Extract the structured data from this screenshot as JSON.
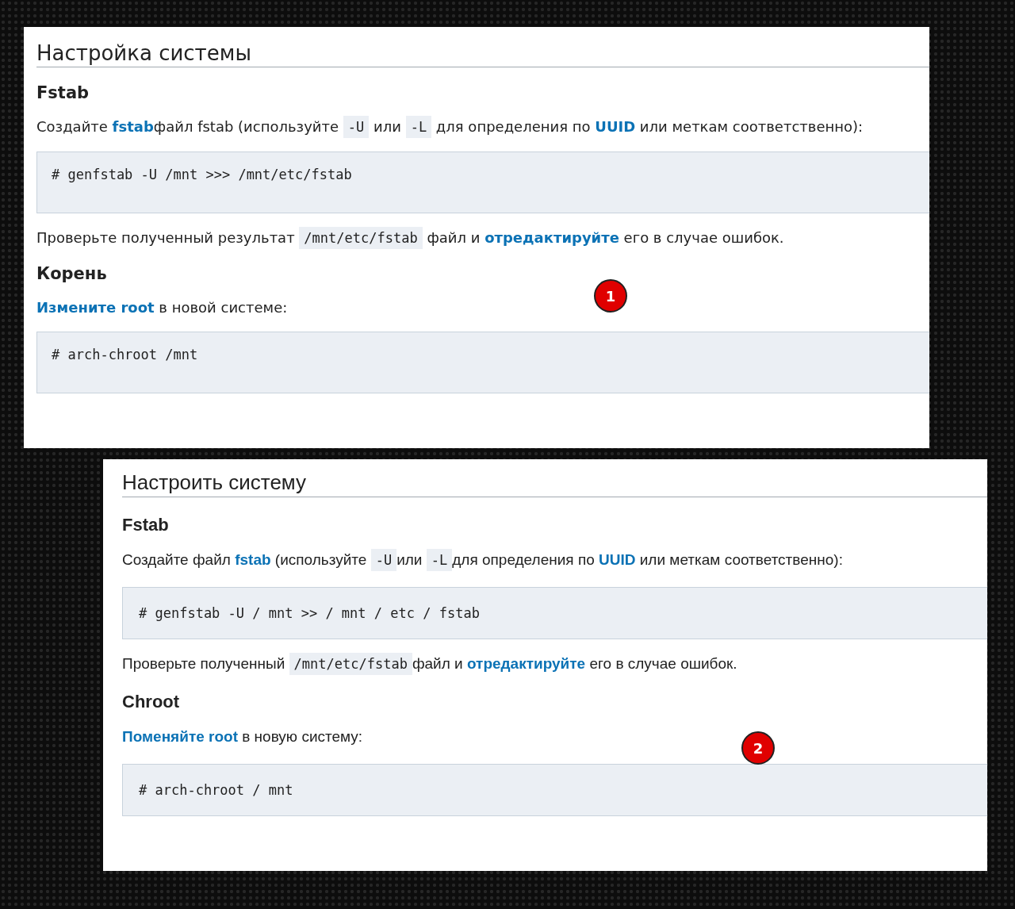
{
  "panels": [
    {
      "badge": "1",
      "title": "Настройка системы",
      "sections": [
        {
          "heading": "Fstab",
          "blocks": [
            {
              "kind": "paragraph",
              "parts": [
                {
                  "kind": "text",
                  "text": "Создайте "
                },
                {
                  "kind": "link",
                  "text": "fstab"
                },
                {
                  "kind": "text",
                  "text": "файл fstab (используйте "
                },
                {
                  "kind": "code",
                  "text": "-U"
                },
                {
                  "kind": "text",
                  "text": " или "
                },
                {
                  "kind": "code",
                  "text": "-L"
                },
                {
                  "kind": "text",
                  "text": " для определения по "
                },
                {
                  "kind": "link",
                  "text": "UUID"
                },
                {
                  "kind": "text",
                  "text": " или меткам соответственно):"
                }
              ]
            },
            {
              "kind": "code",
              "text": "# genfstab -U /mnt >>> /mnt/etc/fstab"
            },
            {
              "kind": "paragraph",
              "parts": [
                {
                  "kind": "text",
                  "text": "Проверьте полученный результат "
                },
                {
                  "kind": "code",
                  "text": "/mnt/etc/fstab"
                },
                {
                  "kind": "text",
                  "text": " файл и "
                },
                {
                  "kind": "link",
                  "text": "отредактируйте"
                },
                {
                  "kind": "text",
                  "text": " его в случае ошибок."
                }
              ]
            }
          ]
        },
        {
          "heading": "Корень",
          "blocks": [
            {
              "kind": "paragraph",
              "parts": [
                {
                  "kind": "link",
                  "text": "Измените root"
                },
                {
                  "kind": "text",
                  "text": " в новой системе:"
                }
              ]
            },
            {
              "kind": "code",
              "text": "# arch-chroot /mnt"
            }
          ]
        }
      ]
    },
    {
      "badge": "2",
      "title": "Настроить систему",
      "sections": [
        {
          "heading": "Fstab",
          "blocks": [
            {
              "kind": "paragraph",
              "parts": [
                {
                  "kind": "text",
                  "text": "Создайте файл "
                },
                {
                  "kind": "link",
                  "text": "fstab"
                },
                {
                  "kind": "text",
                  "text": " (используйте "
                },
                {
                  "kind": "code",
                  "text": "-U"
                },
                {
                  "kind": "text",
                  "text": "или "
                },
                {
                  "kind": "code",
                  "text": "-L"
                },
                {
                  "kind": "text",
                  "text": "для определения по "
                },
                {
                  "kind": "link",
                  "text": "UUID"
                },
                {
                  "kind": "text",
                  "text": " или меткам соответственно):"
                }
              ]
            },
            {
              "kind": "code",
              "text": "# genfstab -U / mnt >> / mnt / etc / fstab"
            },
            {
              "kind": "paragraph",
              "parts": [
                {
                  "kind": "text",
                  "text": "Проверьте полученный "
                },
                {
                  "kind": "code",
                  "text": "/mnt/etc/fstab"
                },
                {
                  "kind": "text",
                  "text": "файл и "
                },
                {
                  "kind": "link",
                  "text": "отредактируйте"
                },
                {
                  "kind": "text",
                  "text": " его в случае ошибок."
                }
              ]
            }
          ]
        },
        {
          "heading": "Chroot",
          "blocks": [
            {
              "kind": "paragraph",
              "parts": [
                {
                  "kind": "link",
                  "text": "Поменяйте root"
                },
                {
                  "kind": "text",
                  "text": " в новую систему:"
                }
              ]
            },
            {
              "kind": "code",
              "text": "# arch-chroot / mnt"
            }
          ]
        }
      ]
    }
  ]
}
